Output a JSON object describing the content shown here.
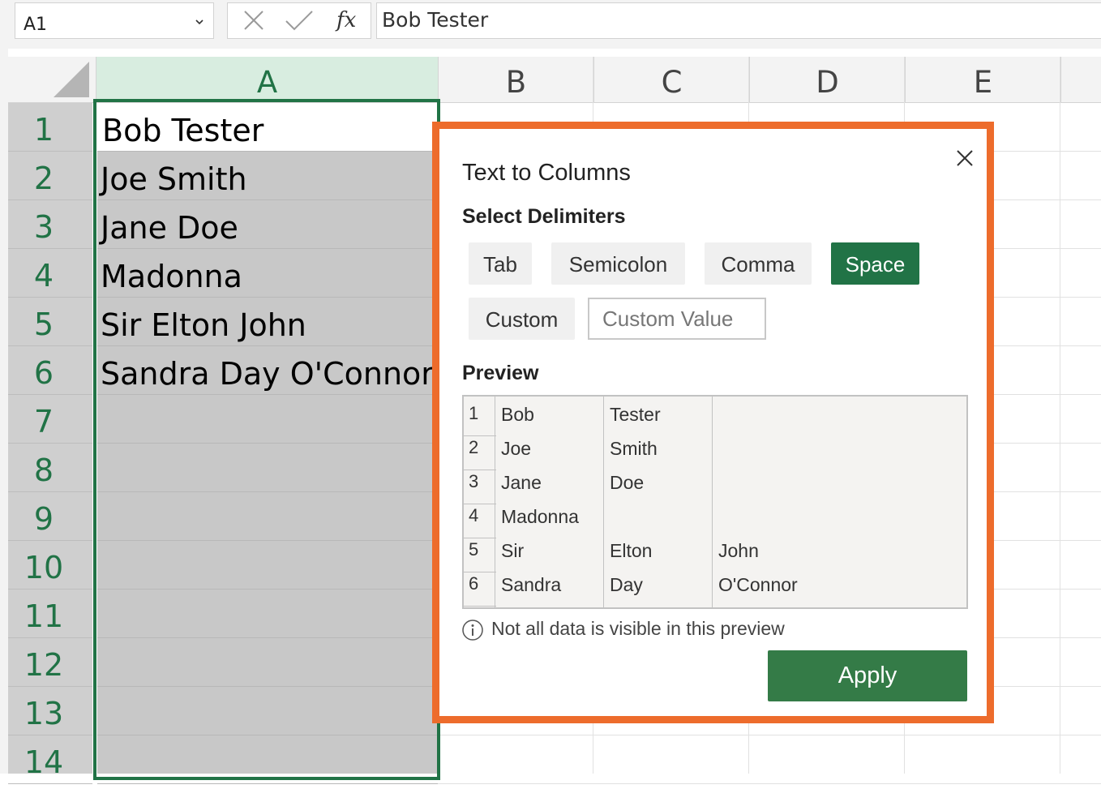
{
  "formula_bar": {
    "name_box": "A1",
    "fx_label": "fx",
    "formula_value": "Bob Tester"
  },
  "columns": [
    "A",
    "B",
    "C",
    "D",
    "E"
  ],
  "rows": [
    "1",
    "2",
    "3",
    "4",
    "5",
    "6",
    "7",
    "8",
    "9",
    "10",
    "11",
    "12",
    "13",
    "14"
  ],
  "column_a_cells": [
    "Bob Tester",
    "Joe Smith",
    "Jane Doe",
    "Madonna",
    "Sir Elton John",
    "Sandra Day O'Connor"
  ],
  "dialog": {
    "title": "Text to Columns",
    "select_delimiters_label": "Select Delimiters",
    "delimiters": {
      "tab": "Tab",
      "semicolon": "Semicolon",
      "comma": "Comma",
      "space": "Space",
      "custom": "Custom"
    },
    "active_delimiter": "Space",
    "custom_value_placeholder": "Custom Value",
    "preview_label": "Preview",
    "preview_rows": [
      {
        "num": "1",
        "c1": "Bob",
        "c2": "Tester",
        "c3": ""
      },
      {
        "num": "2",
        "c1": "Joe",
        "c2": "Smith",
        "c3": ""
      },
      {
        "num": "3",
        "c1": "Jane",
        "c2": "Doe",
        "c3": ""
      },
      {
        "num": "4",
        "c1": "Madonna",
        "c2": "",
        "c3": ""
      },
      {
        "num": "5",
        "c1": "Sir",
        "c2": "Elton",
        "c3": "John"
      },
      {
        "num": "6",
        "c1": "Sandra",
        "c2": "Day",
        "c3": "O'Connor"
      }
    ],
    "info_text": "Not all data is visible in this preview",
    "apply_label": "Apply"
  },
  "colors": {
    "accent_green": "#217346",
    "apply_green": "#347b47",
    "dialog_highlight": "#ed6c2c"
  },
  "icons": {
    "name_box_dropdown": "chevron-down-icon",
    "cancel": "close-x-icon",
    "confirm": "check-icon",
    "dialog_close": "close-icon",
    "info": "info-icon"
  }
}
